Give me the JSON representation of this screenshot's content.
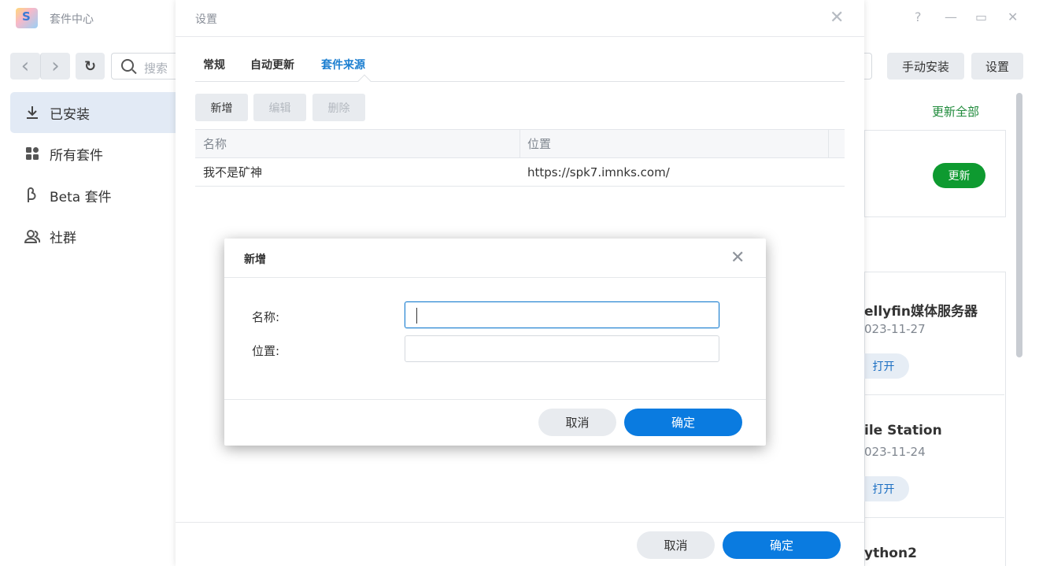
{
  "app": {
    "title": "套件中心",
    "help_glyph": "?",
    "minimize_glyph": "—",
    "maximize_glyph": "▭",
    "close_glyph": "✕"
  },
  "toolbar": {
    "back_glyph": "‹",
    "forward_glyph": "›",
    "refresh_glyph": "↻",
    "search_placeholder": "搜索",
    "manual_install_label": "手动安装",
    "settings_label": "设置"
  },
  "sidebar": {
    "items": [
      {
        "label": "已安装",
        "icon": "download-icon",
        "active": true
      },
      {
        "label": "所有套件",
        "icon": "grid-icon",
        "active": false
      },
      {
        "label": "Beta 套件",
        "icon": "beta-icon",
        "active": false
      },
      {
        "label": "社群",
        "icon": "community-icon",
        "active": false
      }
    ]
  },
  "main": {
    "update_all_label": "更新全部",
    "update_label": "更新",
    "packages": [
      {
        "name": "ellyfin媒体服务器",
        "date": "023-11-27",
        "action": "打开"
      },
      {
        "name": "ile Station",
        "date": "023-11-24",
        "action": "打开"
      },
      {
        "name": "ython2",
        "date": "",
        "action": ""
      }
    ]
  },
  "settings": {
    "title": "设置",
    "close_glyph": "✕",
    "tabs": [
      {
        "label": "常规",
        "active": false
      },
      {
        "label": "自动更新",
        "active": false
      },
      {
        "label": "套件来源",
        "active": true
      }
    ],
    "actions": {
      "add_label": "新增",
      "edit_label": "编辑",
      "delete_label": "删除"
    },
    "table": {
      "columns": [
        "名称",
        "位置"
      ],
      "rows": [
        {
          "name": "我不是矿神",
          "location": "https://spk7.imnks.com/"
        }
      ]
    },
    "cancel_label": "取消",
    "ok_label": "确定"
  },
  "add_modal": {
    "title": "新增",
    "close_glyph": "✕",
    "name_label": "名称:",
    "name_value": "",
    "location_label": "位置:",
    "location_value": "",
    "cancel_label": "取消",
    "ok_label": "确定"
  },
  "colors": {
    "accent": "#0a7be0",
    "tab_active": "#1b7ed0",
    "update_green": "#0e9a30",
    "update_all_green": "#1e8a3a"
  }
}
